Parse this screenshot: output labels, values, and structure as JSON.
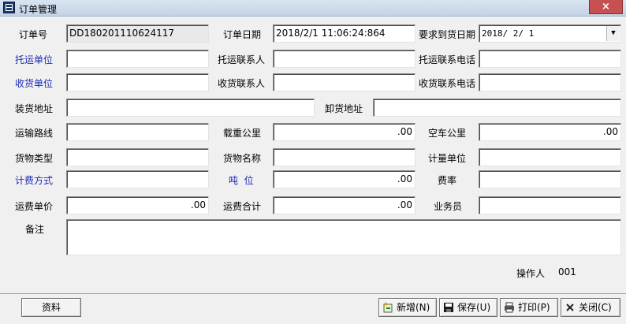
{
  "window": {
    "title": "订单管理",
    "close_glyph": "×"
  },
  "labels": {
    "order_no": "订单号",
    "order_date": "订单日期",
    "required_date": "要求到货日期",
    "shipper": "托运单位",
    "shipper_contact": "托运联系人",
    "shipper_phone": "托运联系电话",
    "consignee": "收货单位",
    "consignee_contact": "收货联系人",
    "consignee_phone": "收货联系电话",
    "load_addr": "装货地址",
    "unload_addr": "卸货地址",
    "route": "运输路线",
    "loaded_km": "载重公里",
    "empty_km": "空车公里",
    "cargo_type": "货物类型",
    "cargo_name": "货物名称",
    "unit": "计量单位",
    "billing_method": "计费方式",
    "tonnage": "吨  位",
    "rate": "费率",
    "unit_price": "运费单价",
    "total_freight": "运费合计",
    "salesperson": "业务员",
    "remarks": "备注",
    "operator": "操作人"
  },
  "values": {
    "order_no": "DD180201110624117",
    "order_date": "2018/2/1 11:06:24:864",
    "required_date": "2018/ 2/ 1",
    "loaded_km": ".00",
    "empty_km": ".00",
    "tonnage": ".00",
    "unit_price": ".00",
    "total_freight": ".00",
    "operator": "001"
  },
  "buttons": {
    "data": "资料",
    "new": "新增(N)",
    "save": "保存(U)",
    "print": "打印(P)",
    "close": "关闭(C)"
  },
  "colors": {
    "link_label": "#1e2ab5",
    "titlebar": "#c4d3e6",
    "close_button": "#c75050"
  },
  "icons": {
    "dropdown": "▼"
  }
}
